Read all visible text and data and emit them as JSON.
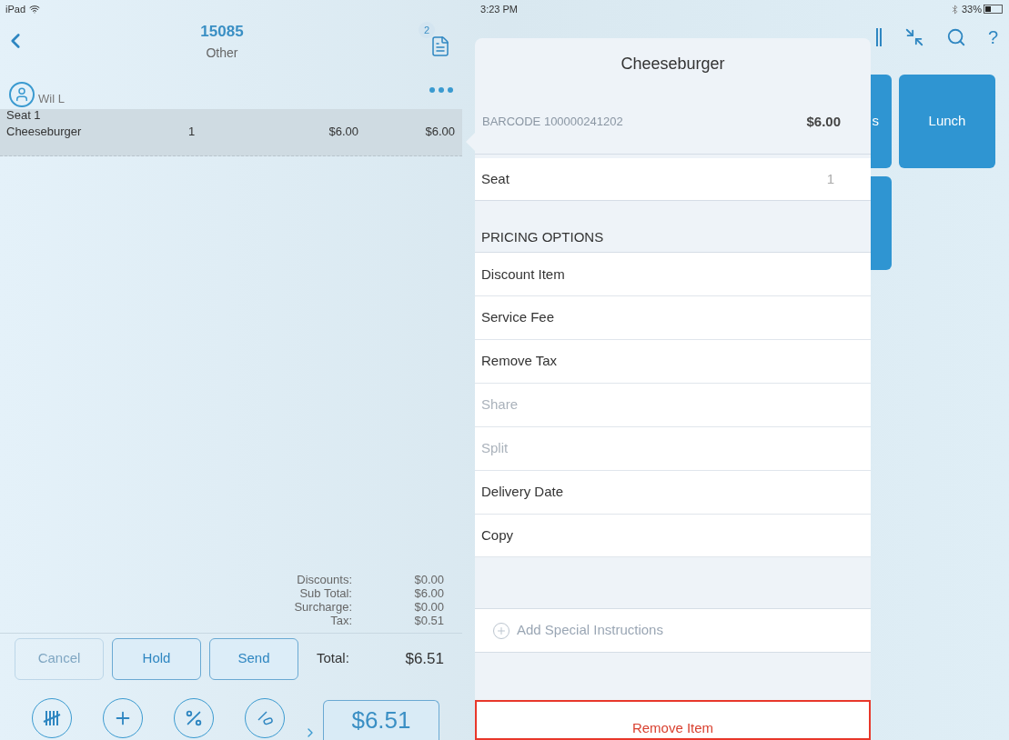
{
  "status_bar": {
    "device": "iPad",
    "time": "3:23 PM",
    "battery": "33%"
  },
  "order": {
    "number": "15085",
    "type": "Other",
    "badge": "2",
    "server": "Wil L",
    "seat": "Seat 1",
    "items": [
      {
        "name": "Cheeseburger",
        "qty": "1",
        "price": "$6.00",
        "total": "$6.00",
        "selected": true
      }
    ],
    "totals": [
      {
        "label": "Discounts:",
        "value": "$0.00"
      },
      {
        "label": "Sub Total:",
        "value": "$6.00"
      },
      {
        "label": "Surcharge:",
        "value": "$0.00"
      },
      {
        "label": "Tax:",
        "value": "$0.51"
      }
    ],
    "buttons": [
      {
        "label": "Cancel",
        "disabled": true
      },
      {
        "label": "Hold",
        "disabled": false
      },
      {
        "label": "Send",
        "disabled": false
      }
    ],
    "total_label": "Total:",
    "total_value": "$6.51",
    "pay_amount": "$6.51"
  },
  "toolbar": {
    "help": "?"
  },
  "menu_tiles": [
    {
      "label": "s"
    },
    {
      "label": "Lunch"
    }
  ],
  "popover": {
    "title": "Cheeseburger",
    "barcode": "BARCODE 100000241202",
    "price": "$6.00",
    "seat_label": "Seat",
    "seat_value": "1",
    "section": "PRICING OPTIONS",
    "options": [
      {
        "label": "Discount Item",
        "disabled": false
      },
      {
        "label": "Service Fee",
        "disabled": false
      },
      {
        "label": "Remove Tax",
        "disabled": false
      },
      {
        "label": "Share",
        "disabled": true
      },
      {
        "label": "Split",
        "disabled": true
      },
      {
        "label": "Delivery Date",
        "disabled": false
      },
      {
        "label": "Copy",
        "disabled": false
      }
    ],
    "special_instructions": "Add Special Instructions",
    "remove": "Remove Item"
  }
}
